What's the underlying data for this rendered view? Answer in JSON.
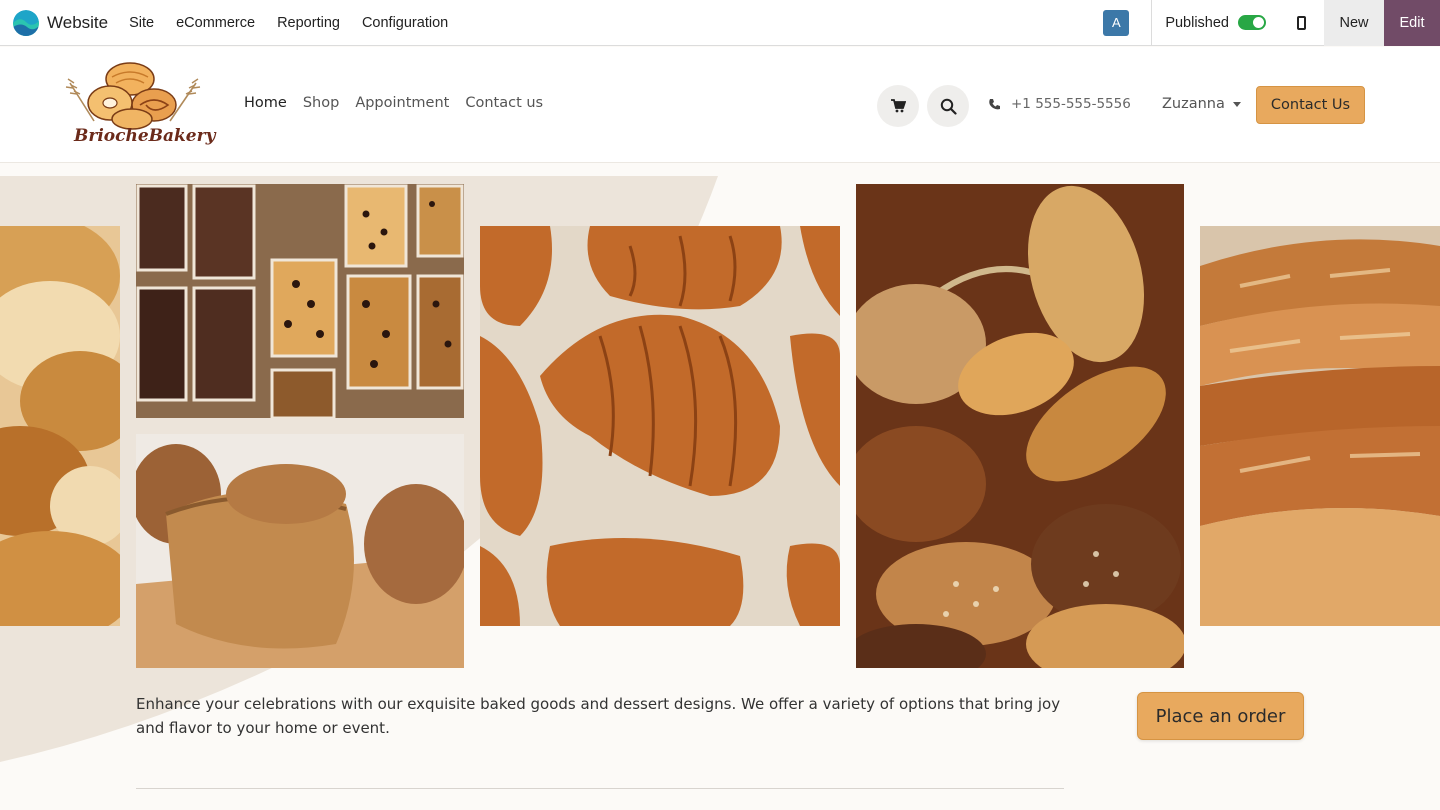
{
  "admin_bar": {
    "app_name": "Website",
    "menus": [
      "Site",
      "eCommerce",
      "Reporting",
      "Configuration"
    ],
    "avatar_letter": "A",
    "published_label": "Published",
    "published": true,
    "new_label": "New",
    "edit_label": "Edit",
    "accent_color": "#714b67"
  },
  "header": {
    "brand": "BriocheBakery",
    "nav": [
      "Home",
      "Shop",
      "Appointment",
      "Contact us"
    ],
    "active_nav": "Home",
    "phone": "+1 555-555-5556",
    "user": "Zuzanna",
    "contact_label": "Contact Us",
    "button_color": "#e8a95e"
  },
  "hero": {
    "images": [
      {
        "name": "brioche-rolls-image",
        "subject": "brioche rolls"
      },
      {
        "name": "chocolate-loaves-image",
        "subject": "chocolate chip loaf cakes"
      },
      {
        "name": "bread-loaves-image",
        "subject": "bread loaves on board"
      },
      {
        "name": "croissants-image",
        "subject": "croissants"
      },
      {
        "name": "bread-basket-image",
        "subject": "assorted bread basket"
      },
      {
        "name": "baguettes-image",
        "subject": "baguettes"
      }
    ],
    "description": "Enhance your celebrations with our exquisite baked goods and dessert designs. We offer a variety of options that bring joy and flavor to your home or event.",
    "order_label": "Place an order"
  }
}
